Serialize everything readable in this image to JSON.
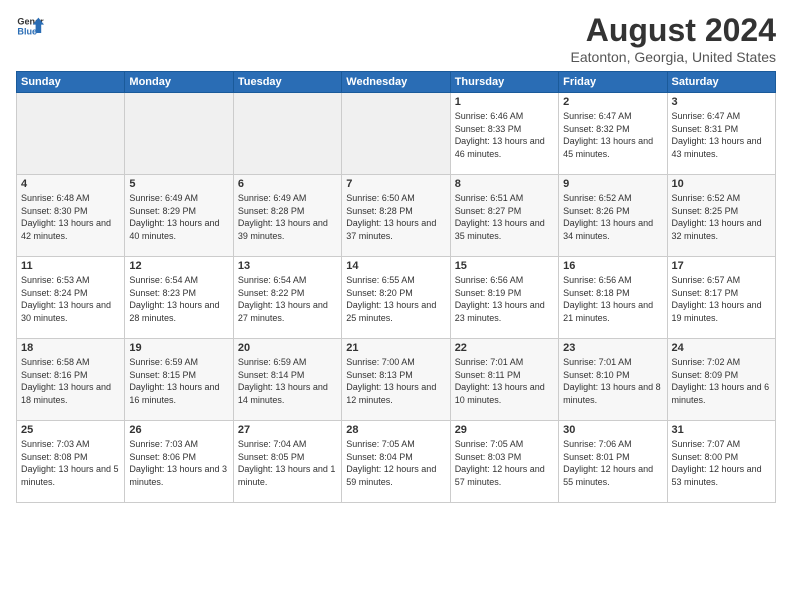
{
  "header": {
    "logo_line1": "General",
    "logo_line2": "Blue",
    "month_year": "August 2024",
    "location": "Eatonton, Georgia, United States"
  },
  "weekdays": [
    "Sunday",
    "Monday",
    "Tuesday",
    "Wednesday",
    "Thursday",
    "Friday",
    "Saturday"
  ],
  "weeks": [
    [
      {
        "day": "",
        "sunrise": "",
        "sunset": "",
        "daylight": "",
        "empty": true
      },
      {
        "day": "",
        "sunrise": "",
        "sunset": "",
        "daylight": "",
        "empty": true
      },
      {
        "day": "",
        "sunrise": "",
        "sunset": "",
        "daylight": "",
        "empty": true
      },
      {
        "day": "",
        "sunrise": "",
        "sunset": "",
        "daylight": "",
        "empty": true
      },
      {
        "day": "1",
        "sunrise": "6:46 AM",
        "sunset": "8:33 PM",
        "daylight": "13 hours and 46 minutes."
      },
      {
        "day": "2",
        "sunrise": "6:47 AM",
        "sunset": "8:32 PM",
        "daylight": "13 hours and 45 minutes."
      },
      {
        "day": "3",
        "sunrise": "6:47 AM",
        "sunset": "8:31 PM",
        "daylight": "13 hours and 43 minutes."
      }
    ],
    [
      {
        "day": "4",
        "sunrise": "6:48 AM",
        "sunset": "8:30 PM",
        "daylight": "13 hours and 42 minutes."
      },
      {
        "day": "5",
        "sunrise": "6:49 AM",
        "sunset": "8:29 PM",
        "daylight": "13 hours and 40 minutes."
      },
      {
        "day": "6",
        "sunrise": "6:49 AM",
        "sunset": "8:28 PM",
        "daylight": "13 hours and 39 minutes."
      },
      {
        "day": "7",
        "sunrise": "6:50 AM",
        "sunset": "8:28 PM",
        "daylight": "13 hours and 37 minutes."
      },
      {
        "day": "8",
        "sunrise": "6:51 AM",
        "sunset": "8:27 PM",
        "daylight": "13 hours and 35 minutes."
      },
      {
        "day": "9",
        "sunrise": "6:52 AM",
        "sunset": "8:26 PM",
        "daylight": "13 hours and 34 minutes."
      },
      {
        "day": "10",
        "sunrise": "6:52 AM",
        "sunset": "8:25 PM",
        "daylight": "13 hours and 32 minutes."
      }
    ],
    [
      {
        "day": "11",
        "sunrise": "6:53 AM",
        "sunset": "8:24 PM",
        "daylight": "13 hours and 30 minutes."
      },
      {
        "day": "12",
        "sunrise": "6:54 AM",
        "sunset": "8:23 PM",
        "daylight": "13 hours and 28 minutes."
      },
      {
        "day": "13",
        "sunrise": "6:54 AM",
        "sunset": "8:22 PM",
        "daylight": "13 hours and 27 minutes."
      },
      {
        "day": "14",
        "sunrise": "6:55 AM",
        "sunset": "8:20 PM",
        "daylight": "13 hours and 25 minutes."
      },
      {
        "day": "15",
        "sunrise": "6:56 AM",
        "sunset": "8:19 PM",
        "daylight": "13 hours and 23 minutes."
      },
      {
        "day": "16",
        "sunrise": "6:56 AM",
        "sunset": "8:18 PM",
        "daylight": "13 hours and 21 minutes."
      },
      {
        "day": "17",
        "sunrise": "6:57 AM",
        "sunset": "8:17 PM",
        "daylight": "13 hours and 19 minutes."
      }
    ],
    [
      {
        "day": "18",
        "sunrise": "6:58 AM",
        "sunset": "8:16 PM",
        "daylight": "13 hours and 18 minutes."
      },
      {
        "day": "19",
        "sunrise": "6:59 AM",
        "sunset": "8:15 PM",
        "daylight": "13 hours and 16 minutes."
      },
      {
        "day": "20",
        "sunrise": "6:59 AM",
        "sunset": "8:14 PM",
        "daylight": "13 hours and 14 minutes."
      },
      {
        "day": "21",
        "sunrise": "7:00 AM",
        "sunset": "8:13 PM",
        "daylight": "13 hours and 12 minutes."
      },
      {
        "day": "22",
        "sunrise": "7:01 AM",
        "sunset": "8:11 PM",
        "daylight": "13 hours and 10 minutes."
      },
      {
        "day": "23",
        "sunrise": "7:01 AM",
        "sunset": "8:10 PM",
        "daylight": "13 hours and 8 minutes."
      },
      {
        "day": "24",
        "sunrise": "7:02 AM",
        "sunset": "8:09 PM",
        "daylight": "13 hours and 6 minutes."
      }
    ],
    [
      {
        "day": "25",
        "sunrise": "7:03 AM",
        "sunset": "8:08 PM",
        "daylight": "13 hours and 5 minutes."
      },
      {
        "day": "26",
        "sunrise": "7:03 AM",
        "sunset": "8:06 PM",
        "daylight": "13 hours and 3 minutes."
      },
      {
        "day": "27",
        "sunrise": "7:04 AM",
        "sunset": "8:05 PM",
        "daylight": "13 hours and 1 minute."
      },
      {
        "day": "28",
        "sunrise": "7:05 AM",
        "sunset": "8:04 PM",
        "daylight": "12 hours and 59 minutes."
      },
      {
        "day": "29",
        "sunrise": "7:05 AM",
        "sunset": "8:03 PM",
        "daylight": "12 hours and 57 minutes."
      },
      {
        "day": "30",
        "sunrise": "7:06 AM",
        "sunset": "8:01 PM",
        "daylight": "12 hours and 55 minutes."
      },
      {
        "day": "31",
        "sunrise": "7:07 AM",
        "sunset": "8:00 PM",
        "daylight": "12 hours and 53 minutes."
      }
    ]
  ],
  "labels": {
    "sunrise": "Sunrise:",
    "sunset": "Sunset:",
    "daylight": "Daylight:"
  }
}
